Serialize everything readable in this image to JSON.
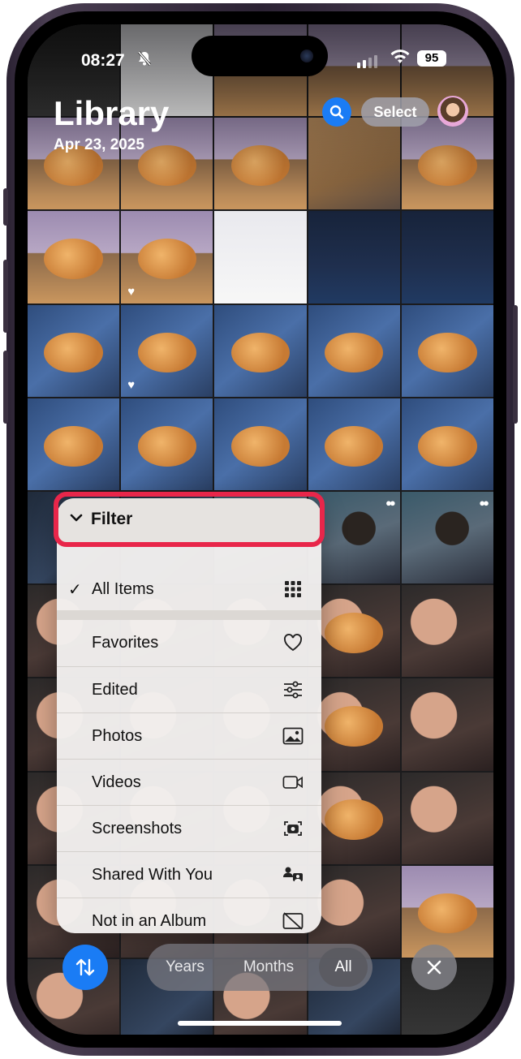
{
  "status": {
    "time": "08:27",
    "battery": "95"
  },
  "header": {
    "title": "Library",
    "date": "Apr 23, 2025",
    "select_label": "Select"
  },
  "filter_menu": {
    "title": "Filter",
    "selected": {
      "label": "All Items",
      "icon": "grid-icon"
    },
    "items": [
      {
        "label": "Favorites",
        "icon": "heart-icon"
      },
      {
        "label": "Edited",
        "icon": "sliders-icon"
      },
      {
        "label": "Photos",
        "icon": "photo-icon"
      },
      {
        "label": "Videos",
        "icon": "video-icon"
      },
      {
        "label": "Screenshots",
        "icon": "screenshot-icon"
      },
      {
        "label": "Shared With You",
        "icon": "shared-with-you-icon"
      },
      {
        "label": "Not in an Album",
        "icon": "not-in-album-icon"
      }
    ]
  },
  "bottom_bar": {
    "segments": [
      "Years",
      "Months",
      "All"
    ],
    "selected_segment": "All"
  },
  "colors": {
    "accent": "#1a7cf5",
    "highlight": "#e8264a"
  }
}
